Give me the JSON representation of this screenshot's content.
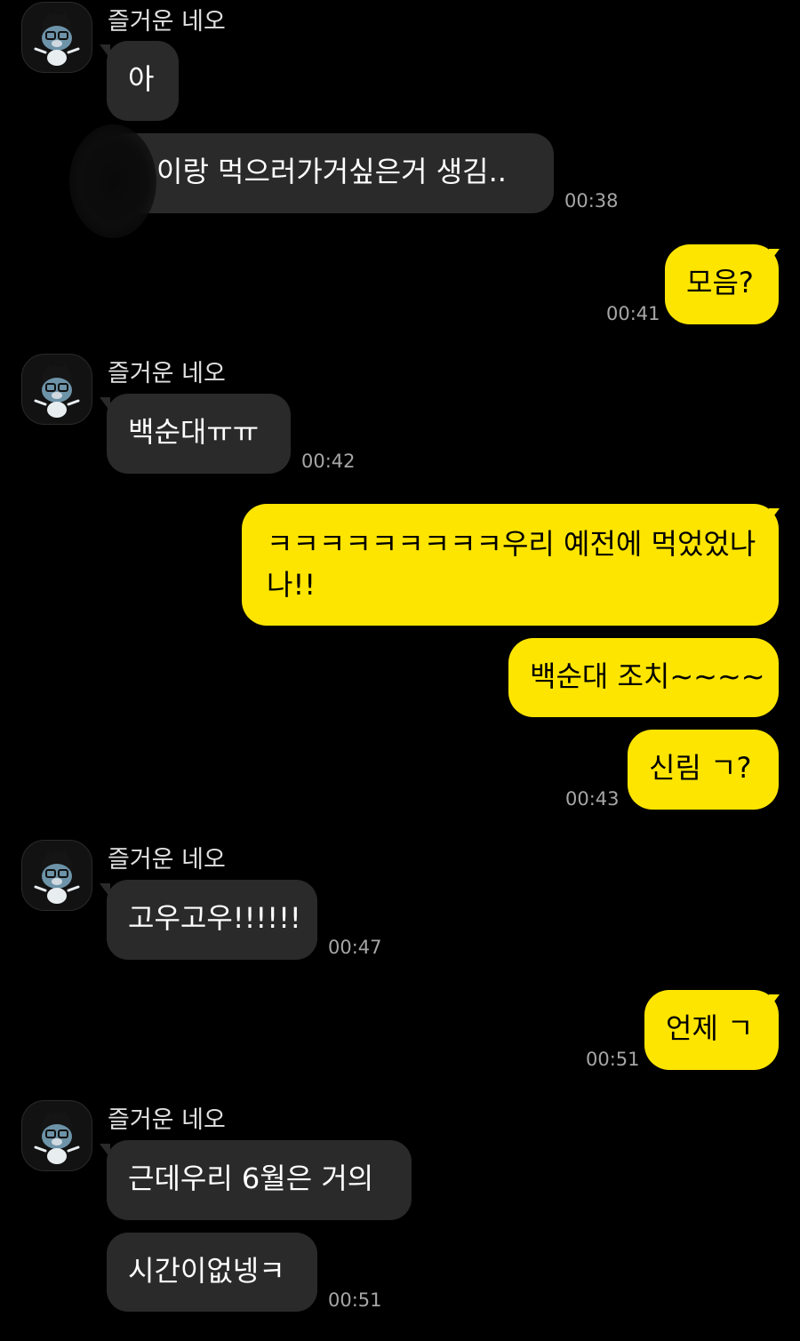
{
  "colors": {
    "background": "#000000",
    "incoming_bubble": "#2a2a2a",
    "outgoing_bubble": "#fee500",
    "timestamp": "#a6a6a6"
  },
  "groups": [
    {
      "sender": "즐거운 네오",
      "avatar_icon": "neo-character-avatar-icon",
      "messages": [
        {
          "text": "아",
          "time": ""
        },
        {
          "text": "이랑 먹으러가거싶은거 생김..",
          "time": "00:38"
        }
      ]
    },
    {
      "sender": "",
      "outgoing": true,
      "messages": [
        {
          "text": "모음?",
          "time": "00:41"
        }
      ]
    },
    {
      "sender": "즐거운 네오",
      "avatar_icon": "neo-character-avatar-icon",
      "messages": [
        {
          "text": "백순대ㅠㅠ",
          "time": "00:42"
        }
      ]
    },
    {
      "sender": "",
      "outgoing": true,
      "messages": [
        {
          "text": "ㅋㅋㅋㅋㅋㅋㅋㅋㅋ우리 예전에 먹었었나 나!!",
          "time": ""
        },
        {
          "text": "백순대 조치~~~~",
          "time": ""
        },
        {
          "text": "신림 ㄱ?",
          "time": "00:43"
        }
      ]
    },
    {
      "sender": "즐거운 네오",
      "avatar_icon": "neo-character-avatar-icon",
      "messages": [
        {
          "text": "고우고우!!!!!!",
          "time": "00:47"
        }
      ]
    },
    {
      "sender": "",
      "outgoing": true,
      "messages": [
        {
          "text": "언제 ㄱ",
          "time": "00:51"
        }
      ]
    },
    {
      "sender": "즐거운 네오",
      "avatar_icon": "neo-character-avatar-icon",
      "messages": [
        {
          "text": "근데우리 6월은 거의",
          "time": ""
        },
        {
          "text": "시간이없넹ㅋ",
          "time": "00:51"
        }
      ]
    }
  ]
}
